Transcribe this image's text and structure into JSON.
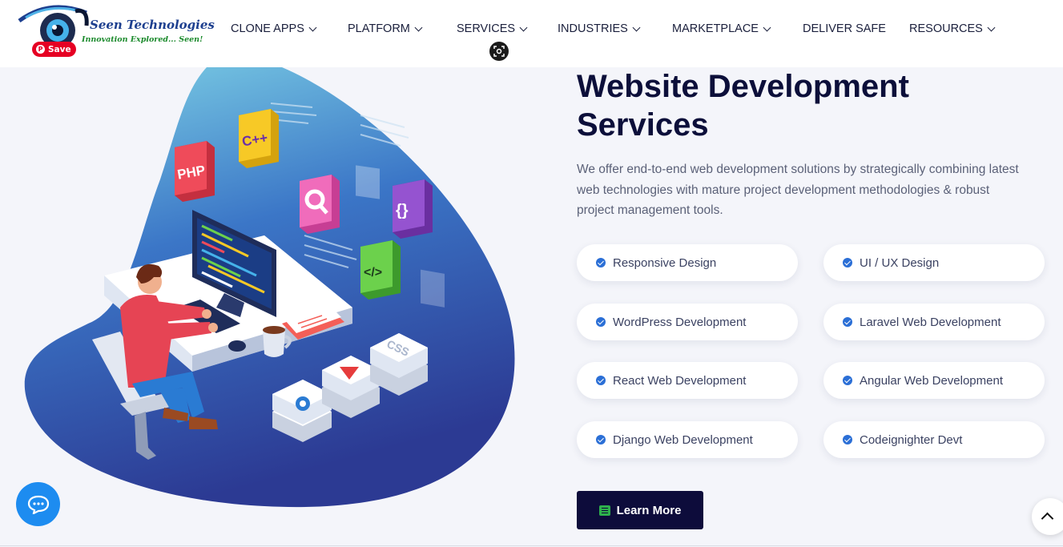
{
  "brand": {
    "name": "Seen Technologies",
    "tagline": "Innovation Explored... Seen!",
    "save_label": "Save"
  },
  "nav": {
    "items": [
      {
        "label": "CLONE APPS",
        "dropdown": true
      },
      {
        "label": "PLATFORM",
        "dropdown": true
      },
      {
        "label": "SERVICES",
        "dropdown": true
      },
      {
        "label": "INDUSTRIES",
        "dropdown": true
      },
      {
        "label": "MARKETPLACE",
        "dropdown": true
      },
      {
        "label": "DELIVER SAFE",
        "dropdown": false
      },
      {
        "label": "RESOURCES",
        "dropdown": true
      }
    ]
  },
  "hero": {
    "title_line1": "Website Development",
    "title_line2": "Services",
    "description": "We offer end-to-end web development solutions by strategically combining latest web technologies with mature project development methodologies & robust project management tools.",
    "features": [
      "Responsive Design",
      "UI / UX Design",
      "WordPress Development",
      "Laravel Web Development",
      "React Web Development",
      "Angular Web Development",
      "Django Web Development",
      "Codeignighter Devt"
    ],
    "cta_label": "Learn More"
  },
  "illustration": {
    "badges": [
      "PHP",
      "C++",
      "{}",
      "</>",
      "CSS"
    ]
  },
  "colors": {
    "navy": "#0c0f3a",
    "accent_blue": "#2b6fd6",
    "button_bg": "#0d0c3b",
    "chat_blue": "#1d8cf0",
    "pinterest_red": "#e60023"
  },
  "icons": [
    "pinterest-icon",
    "lens-icon",
    "check-icon",
    "list-icon",
    "chat-icon",
    "arrow-up-icon"
  ]
}
